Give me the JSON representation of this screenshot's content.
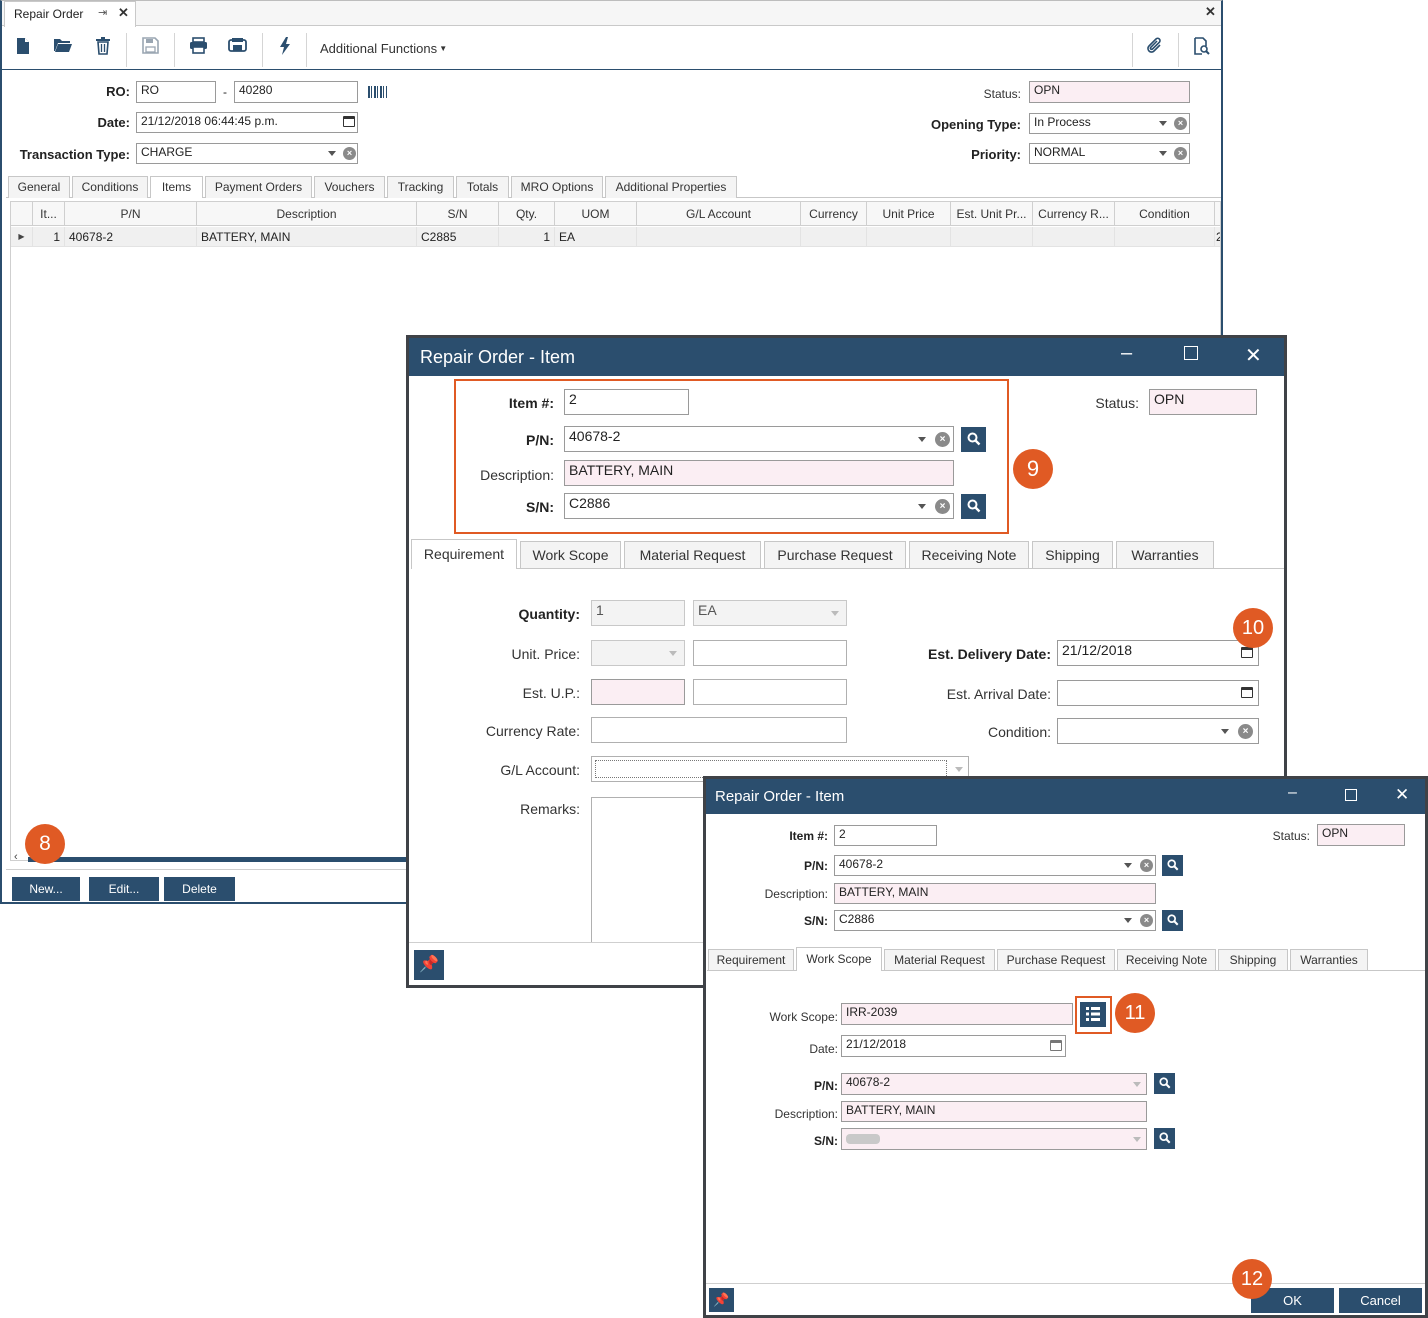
{
  "main_window": {
    "tab_title": "Repair Order",
    "toolbar": {
      "additional_functions": "Additional Functions"
    },
    "fields": {
      "ro_label": "RO:",
      "ro_prefix": "RO",
      "ro_dash": "-",
      "ro_number": "40280",
      "date_label": "Date:",
      "date_value": "21/12/2018 06:44:45 p.m.",
      "transaction_type_label": "Transaction Type:",
      "transaction_type_value": "CHARGE",
      "status_label": "Status:",
      "status_value": "OPN",
      "opening_type_label": "Opening Type:",
      "opening_type_value": "In Process",
      "priority_label": "Priority:",
      "priority_value": "NORMAL"
    },
    "tabs": [
      "General",
      "Conditions",
      "Items",
      "Payment Orders",
      "Vouchers",
      "Tracking",
      "Totals",
      "MRO Options",
      "Additional Properties"
    ],
    "grid": {
      "columns": [
        "It...",
        "P/N",
        "Description",
        "S/N",
        "Qty.",
        "UOM",
        "G/L Account",
        "Currency",
        "Unit Price",
        "Est. Unit Pr...",
        "Currency R...",
        "Condition"
      ],
      "rows": [
        {
          "item": "1",
          "pn": "40678-2",
          "description": "BATTERY, MAIN",
          "sn": "C2885",
          "qty": "1",
          "uom": "EA",
          "overflow": "2"
        }
      ]
    },
    "buttons": {
      "new": "New...",
      "edit": "Edit...",
      "delete": "Delete"
    }
  },
  "dialog1": {
    "title": "Repair Order - Item",
    "item_label": "Item #:",
    "item_value": "2",
    "status_label": "Status:",
    "status_value": "OPN",
    "pn_label": "P/N:",
    "pn_value": "40678-2",
    "description_label": "Description:",
    "description_value": "BATTERY, MAIN",
    "sn_label": "S/N:",
    "sn_value": "C2886",
    "tabs": [
      "Requirement",
      "Work Scope",
      "Material Request",
      "Purchase Request",
      "Receiving Note",
      "Shipping",
      "Warranties"
    ],
    "quantity_label": "Quantity:",
    "quantity_value": "1",
    "uom_value": "EA",
    "unit_price_label": "Unit. Price:",
    "est_up_label": "Est. U.P.:",
    "currency_rate_label": "Currency Rate:",
    "gl_account_label": "G/L Account:",
    "remarks_label": "Remarks:",
    "est_delivery_label": "Est. Delivery Date:",
    "est_delivery_value": "21/12/2018",
    "est_arrival_label": "Est. Arrival Date:",
    "condition_label": "Condition:"
  },
  "dialog2": {
    "title": "Repair Order - Item",
    "item_label": "Item #:",
    "item_value": "2",
    "status_label": "Status:",
    "status_value": "OPN",
    "pn_label": "P/N:",
    "pn_value": "40678-2",
    "description_label": "Description:",
    "description_value": "BATTERY, MAIN",
    "sn_label": "S/N:",
    "sn_value": "C2886",
    "tabs": [
      "Requirement",
      "Work Scope",
      "Material Request",
      "Purchase Request",
      "Receiving Note",
      "Shipping",
      "Warranties"
    ],
    "work_scope_label": "Work Scope:",
    "work_scope_value": "IRR-2039",
    "date_label": "Date:",
    "date_value": "21/12/2018",
    "ws_pn_label": "P/N:",
    "ws_pn_value": "40678-2",
    "ws_description_label": "Description:",
    "ws_description_value": "BATTERY, MAIN",
    "ws_sn_label": "S/N:",
    "ok_label": "OK",
    "cancel_label": "Cancel"
  },
  "callouts": {
    "c8": "8",
    "c9": "9",
    "c10": "10",
    "c11": "11",
    "c12": "12"
  },
  "colors": {
    "accent": "#2b4e6e",
    "callout": "#e05a24",
    "readonly_bg": "#fbeef3"
  }
}
